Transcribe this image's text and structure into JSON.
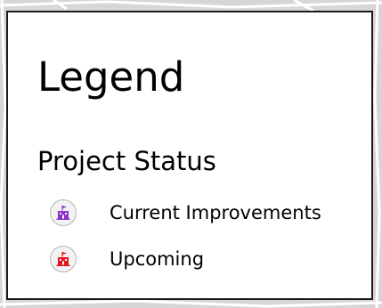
{
  "legend": {
    "title": "Legend",
    "section_title": "Project Status",
    "items": [
      {
        "label": "Current Improvements",
        "icon": "building-flag-icon",
        "color": "#8b2fc9"
      },
      {
        "label": "Upcoming",
        "icon": "building-flag-icon",
        "color": "#e8141c"
      }
    ]
  }
}
